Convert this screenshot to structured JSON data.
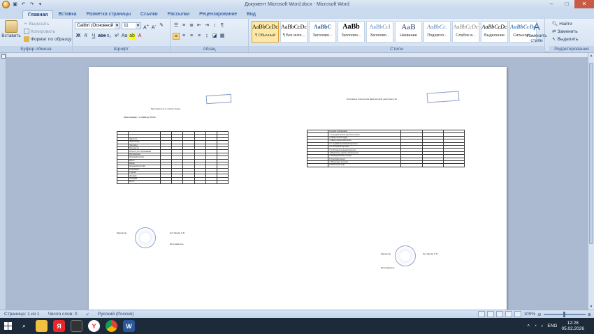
{
  "window": {
    "title": "Документ Microsoft Word.docx - Microsoft Word",
    "minimize": "–",
    "maximize": "□",
    "close": "✕"
  },
  "tabs": [
    "Главная",
    "Вставка",
    "Разметка страницы",
    "Ссылки",
    "Рассылки",
    "Рецензирование",
    "Вид"
  ],
  "clipboard": {
    "paste": "Вставить",
    "cut": "Вырезать",
    "copy": "Копировать",
    "format_painter": "Формат по образцу",
    "label": "Буфер обмена"
  },
  "font": {
    "name": "Calibri (Основной те",
    "size": "11",
    "label": "Шрифт"
  },
  "paragraph": {
    "label": "Абзац"
  },
  "styles": {
    "label": "Стили",
    "items": [
      {
        "sample": "AaBbCcDc",
        "name": "¶ Обычный"
      },
      {
        "sample": "AaBbCcDc",
        "name": "¶ Без инте..."
      },
      {
        "sample": "AaBbC",
        "name": "Заголово..."
      },
      {
        "sample": "AaBb",
        "name": "Заголово..."
      },
      {
        "sample": "AaBbCcl",
        "name": "Заголово..."
      },
      {
        "sample": "AaB",
        "name": "Название"
      },
      {
        "sample": "AaBbCc.",
        "name": "Подзагол..."
      },
      {
        "sample": "AaBbCcDc",
        "name": "Слабое в..."
      },
      {
        "sample": "AaBbCcDc",
        "name": "Выделение"
      },
      {
        "sample": "AaBbCcDc",
        "name": "Сильное ..."
      }
    ],
    "change_styles": "Изменить стили"
  },
  "editing": {
    "find": "Найти",
    "replace": "Заменить",
    "select": "Выделить",
    "label": "Редактирование"
  },
  "scan_left": {
    "header": "Численность и оплата труда",
    "date": "Приложение 1 к приказу 2024г.",
    "director": "Директор",
    "director_name": "Дегтярева С.Б.",
    "executor": "Исполнитель",
    "rows": [
      "",
      "",
      "Директор",
      "Заместитель",
      "Зам.завед.",
      "Методисты",
      "Педагог доп. образования",
      "Воспитатели",
      "Младший воспит.",
      "Итого",
      "Повар",
      "Кухонный рабочий",
      "Кладовщик",
      "Сторож",
      "Дворник",
      "Уборщик",
      "Итого"
    ]
  },
  "scan_right": {
    "header": "Основные показатели финансовой деятельности",
    "director": "Директор",
    "director_name": "Дегтярева С.Б.",
    "executor": "Исполнитель",
    "rows": [
      "Средние образование",
      "1. Среднемесячная заработная плата",
      "2. Фонд оплаты труда",
      "3. Фонд заработной платы",
      "3.1. Административный персонал",
      "3.2. Основной персонал",
      "3.3. Вспомогательный персонал",
      "4. Выплаты и другие обязательства",
      "5. Коммунальные расходы",
      "6. Текущий ремонт",
      "7. Налоговые платежи",
      "8. Прочие расходы"
    ]
  },
  "status": {
    "page": "Страница: 1 из 1",
    "words": "Число слов: 0",
    "language": "Русский (Россия)",
    "zoom": "100%"
  },
  "taskbar": {
    "language": "ENG",
    "time": "12:28",
    "date": "05.02.2026"
  }
}
